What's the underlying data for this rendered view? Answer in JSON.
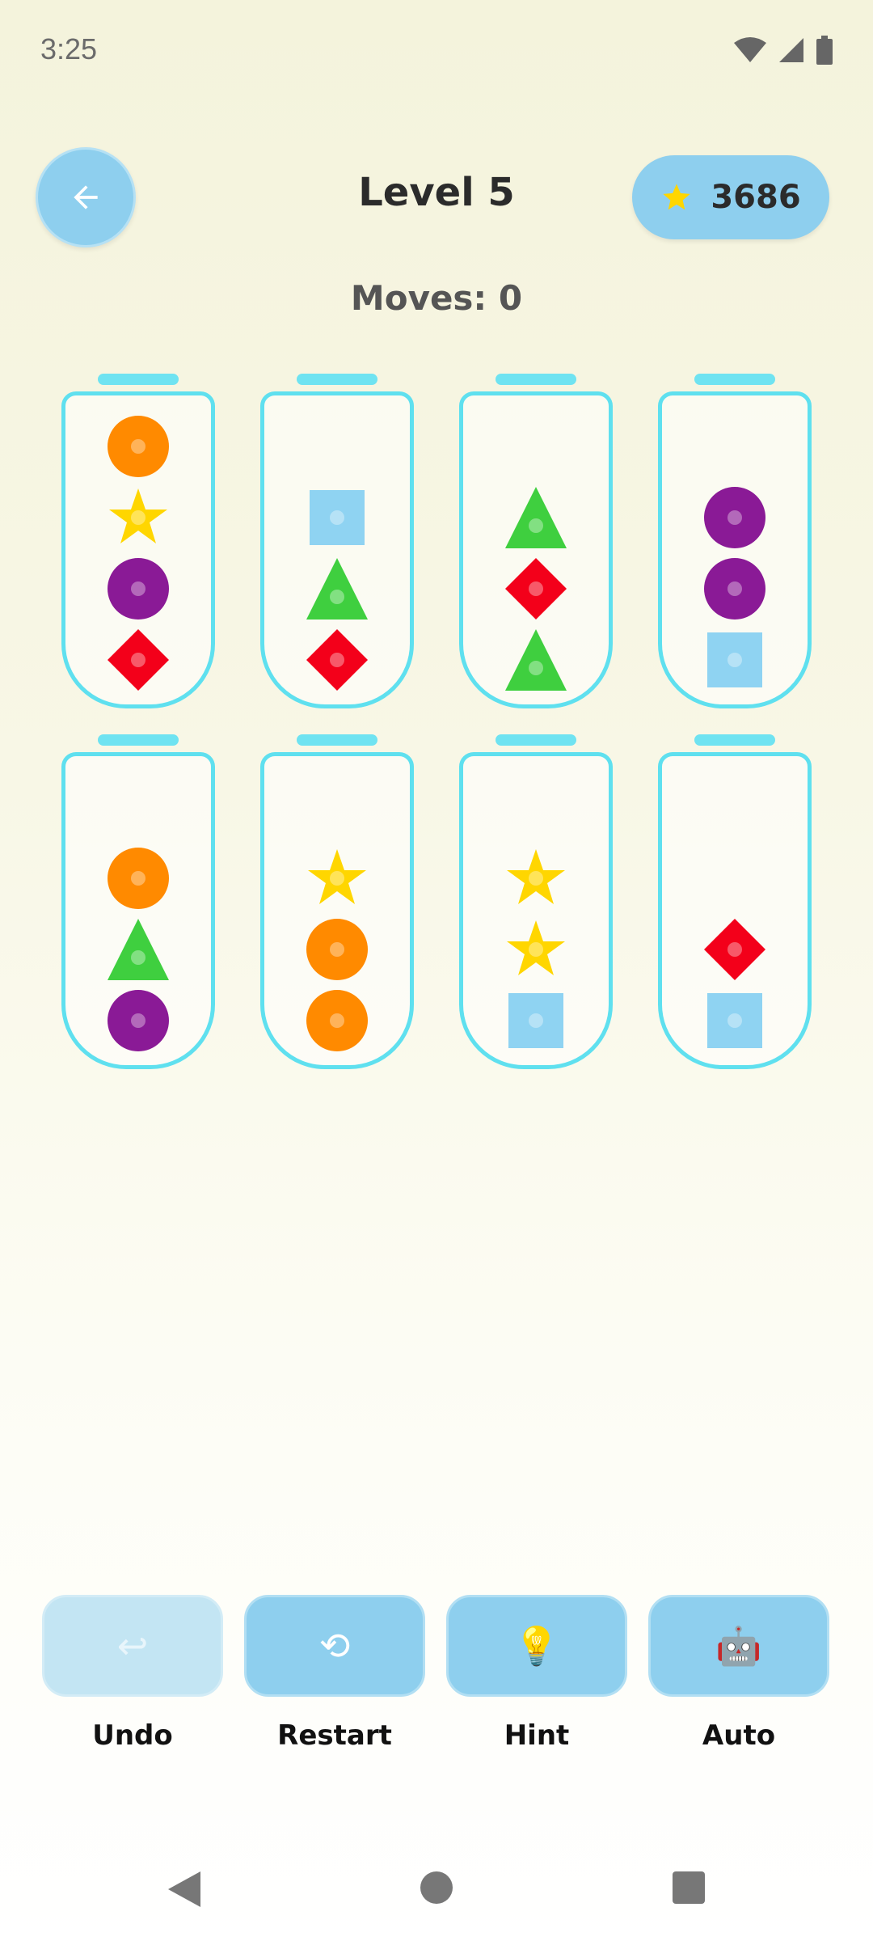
{
  "status_bar": {
    "time": "3:25"
  },
  "header": {
    "back_icon": "arrow-left-icon",
    "title": "Level 5",
    "score_icon": "star-icon",
    "score": "3686",
    "moves_label": "Moves: 0"
  },
  "colors": {
    "accent": "#8ecfee",
    "tube_border": "#5fe0ef",
    "orange": "#ff8a00",
    "yellow": "#ffd600",
    "purple": "#8a1a96",
    "red": "#f3001a",
    "green": "#3fcf3f",
    "blue": "#8fd3f2"
  },
  "tubes": [
    {
      "items": [
        "orange-circle",
        "yellow-star",
        "purple-circle",
        "red-diamond"
      ]
    },
    {
      "items": [
        "blue-square",
        "green-triangle",
        "red-diamond"
      ]
    },
    {
      "items": [
        "green-triangle",
        "red-diamond",
        "green-triangle"
      ]
    },
    {
      "items": [
        "purple-circle",
        "purple-circle",
        "blue-square"
      ]
    },
    {
      "items": [
        "orange-circle",
        "green-triangle",
        "purple-circle"
      ]
    },
    {
      "items": [
        "yellow-star",
        "orange-circle",
        "orange-circle"
      ]
    },
    {
      "items": [
        "yellow-star",
        "yellow-star",
        "blue-square"
      ]
    },
    {
      "items": [
        "red-diamond",
        "blue-square"
      ]
    }
  ],
  "actions": [
    {
      "label": "Undo",
      "icon": "undo-icon",
      "glyph": "↩",
      "disabled": true
    },
    {
      "label": "Restart",
      "icon": "restart-icon",
      "glyph": "⟲",
      "disabled": false
    },
    {
      "label": "Hint",
      "icon": "lightbulb-icon",
      "glyph": "💡",
      "disabled": false
    },
    {
      "label": "Auto",
      "icon": "robot-icon",
      "glyph": "🤖",
      "disabled": false
    }
  ]
}
